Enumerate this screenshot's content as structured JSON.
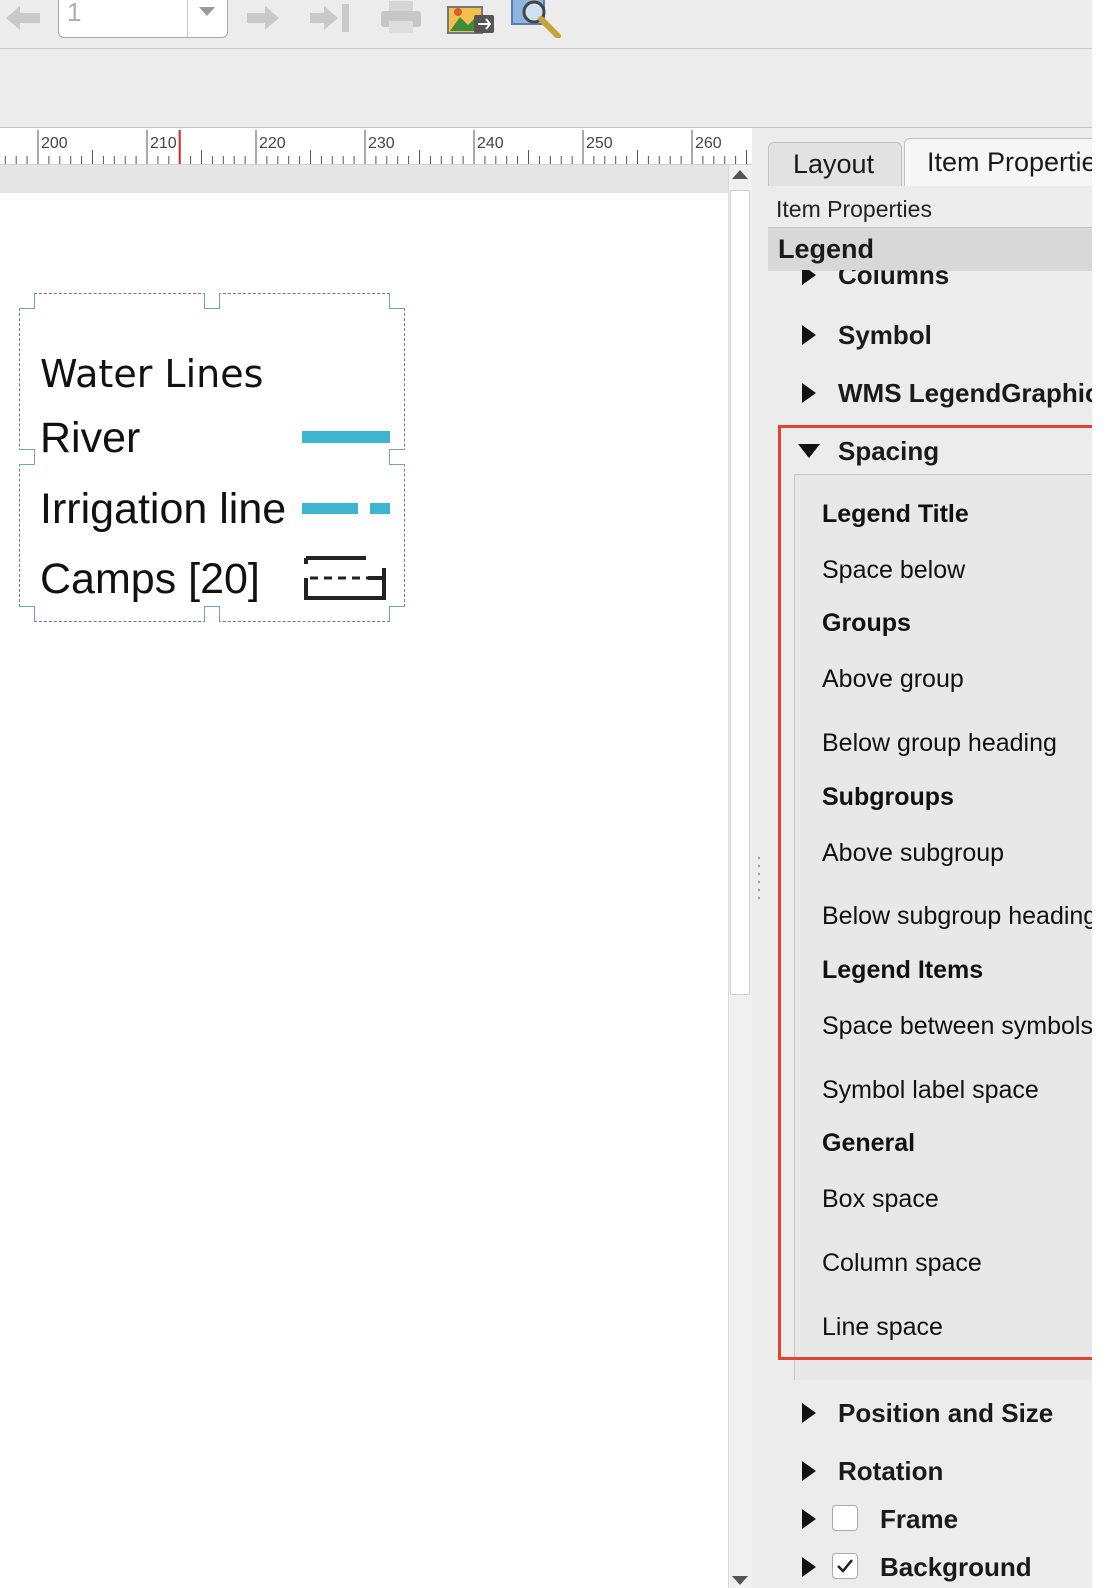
{
  "toolbar": {
    "page_number": "1",
    "icons": [
      "arrow-left-icon",
      "arrow-right-icon",
      "last-page-icon",
      "print-icon",
      "export-image-icon",
      "zoom-tool-icon"
    ]
  },
  "ruler": {
    "labels": [
      "200",
      "210",
      "220",
      "230",
      "240",
      "250",
      "260"
    ],
    "marker_value": 213
  },
  "legend_item": {
    "title": "Water Lines",
    "items": [
      {
        "label": "River",
        "symbol": "solid-line"
      },
      {
        "label": "Irrigation line",
        "symbol": "dashed-line"
      },
      {
        "label": "Camps [20]",
        "symbol": "dashed-rect"
      }
    ],
    "symbol_color": "#3db5d3"
  },
  "panel": {
    "tabs": [
      "Layout",
      "Item Properties"
    ],
    "subtitle": "Item Properties",
    "header": "Legend",
    "groups_top": [
      "Columns",
      "Symbol",
      "WMS LegendGraphic"
    ],
    "spacing": {
      "label": "Spacing",
      "rows": [
        {
          "text": "Legend Title",
          "heading": true
        },
        {
          "text": "Space below",
          "heading": false
        },
        {
          "text": "Groups",
          "heading": true
        },
        {
          "text": "Above group",
          "heading": false
        },
        {
          "text": "Below group heading",
          "heading": false
        },
        {
          "text": "Subgroups",
          "heading": true
        },
        {
          "text": "Above subgroup",
          "heading": false
        },
        {
          "text": "Below subgroup heading",
          "heading": false
        },
        {
          "text": "Legend Items",
          "heading": true
        },
        {
          "text": "Space between symbols",
          "heading": false
        },
        {
          "text": "Symbol label space",
          "heading": false
        },
        {
          "text": "General",
          "heading": true
        },
        {
          "text": "Box space",
          "heading": false
        },
        {
          "text": "Column space",
          "heading": false
        },
        {
          "text": "Line space",
          "heading": false
        }
      ]
    },
    "groups_bottom": [
      "Position and Size",
      "Rotation"
    ],
    "frame_label": "Frame",
    "background_label": "Background",
    "frame_checked": false,
    "background_checked": true,
    "highlight_color": "#e0432f"
  }
}
